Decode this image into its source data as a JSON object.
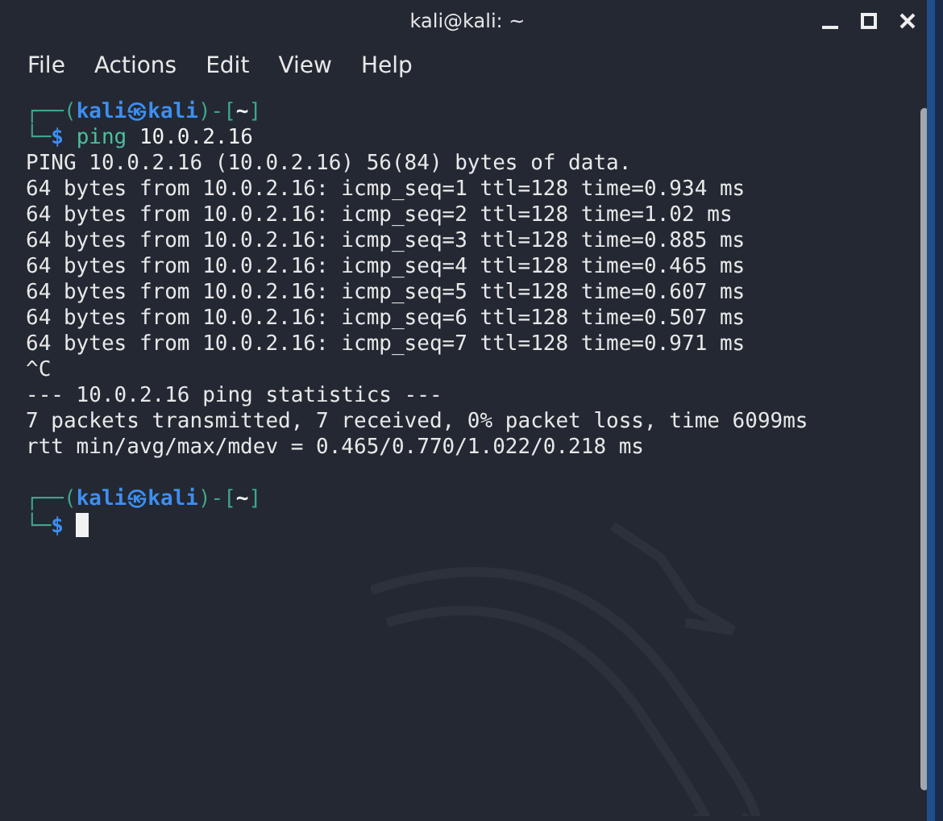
{
  "window": {
    "title": "kali@kali: ~",
    "controls": [
      {
        "kind": "minimize"
      },
      {
        "kind": "maximize"
      },
      {
        "kind": "close"
      }
    ]
  },
  "menu": [
    "File",
    "Actions",
    "Edit",
    "View",
    "Help"
  ],
  "terminal": [
    {
      "kind": "prompt",
      "open": "┌──(",
      "user": "kali",
      "at": "㉿",
      "host": "kali",
      "mid": ")-[",
      "dir": "~",
      "end": "]",
      "corner": "└─",
      "sign": "$",
      "program": "ping",
      "args": "10.0.2.16",
      "cursor": false
    },
    {
      "kind": "output",
      "text": "PING 10.0.2.16 (10.0.2.16) 56(84) bytes of data."
    },
    {
      "kind": "output",
      "text": "64 bytes from 10.0.2.16: icmp_seq=1 ttl=128 time=0.934 ms"
    },
    {
      "kind": "output",
      "text": "64 bytes from 10.0.2.16: icmp_seq=2 ttl=128 time=1.02 ms"
    },
    {
      "kind": "output",
      "text": "64 bytes from 10.0.2.16: icmp_seq=3 ttl=128 time=0.885 ms"
    },
    {
      "kind": "output",
      "text": "64 bytes from 10.0.2.16: icmp_seq=4 ttl=128 time=0.465 ms"
    },
    {
      "kind": "output",
      "text": "64 bytes from 10.0.2.16: icmp_seq=5 ttl=128 time=0.607 ms"
    },
    {
      "kind": "output",
      "text": "64 bytes from 10.0.2.16: icmp_seq=6 ttl=128 time=0.507 ms"
    },
    {
      "kind": "output",
      "text": "64 bytes from 10.0.2.16: icmp_seq=7 ttl=128 time=0.971 ms"
    },
    {
      "kind": "output",
      "text": "^C"
    },
    {
      "kind": "output",
      "text": "--- 10.0.2.16 ping statistics ---"
    },
    {
      "kind": "output",
      "text": "7 packets transmitted, 7 received, 0% packet loss, time 6099ms"
    },
    {
      "kind": "output",
      "text": "rtt min/avg/max/mdev = 0.465/0.770/1.022/0.218 ms"
    },
    {
      "kind": "blank"
    },
    {
      "kind": "prompt",
      "open": "┌──(",
      "user": "kali",
      "at": "㉿",
      "host": "kali",
      "mid": ")-[",
      "dir": "~",
      "end": "]",
      "corner": "└─",
      "sign": "$",
      "cursor": true
    }
  ]
}
